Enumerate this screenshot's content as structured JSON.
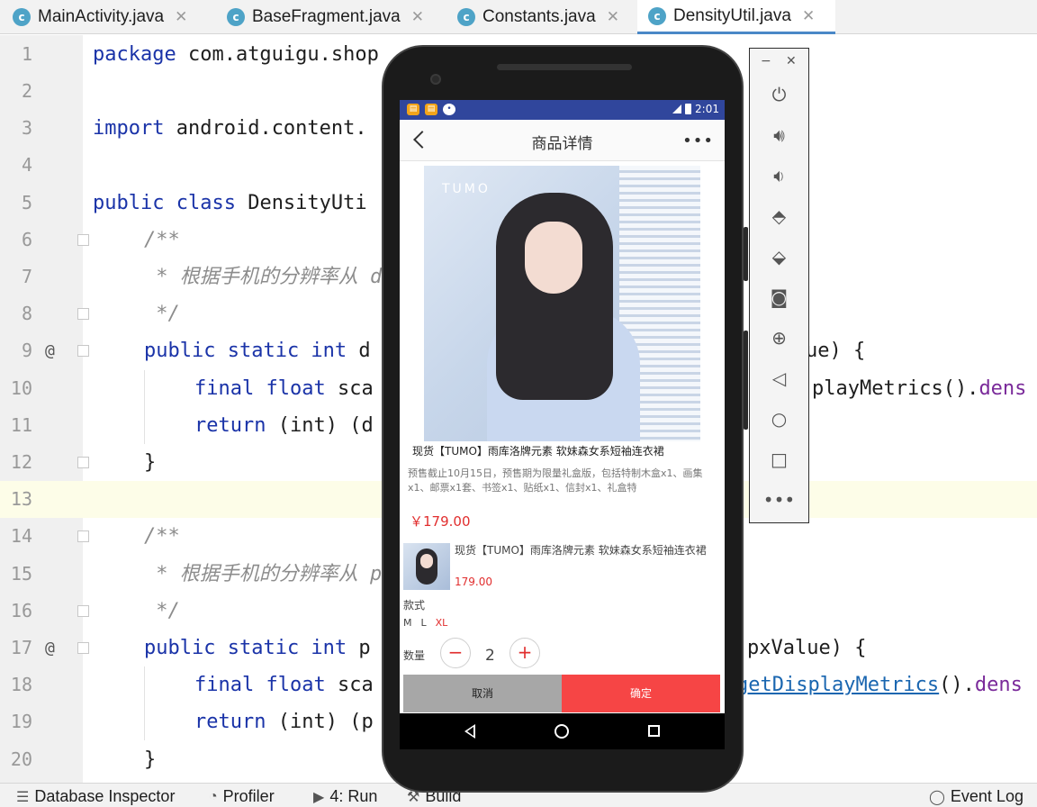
{
  "tabs": [
    {
      "label": "MainActivity.java",
      "icon": "c"
    },
    {
      "label": "BaseFragment.java",
      "icon": "c"
    },
    {
      "label": "Constants.java",
      "icon": "c"
    },
    {
      "label": "DensityUtil.java",
      "icon": "c"
    }
  ],
  "editor": {
    "line_numbers": [
      "1",
      "2",
      "3",
      "4",
      "5",
      "6",
      "7",
      "8",
      "9",
      "10",
      "11",
      "12",
      "13",
      "14",
      "15",
      "16",
      "17",
      "18",
      "19",
      "20"
    ],
    "lines": {
      "l1_pkg_kw": "package",
      "l1_pkg_name": " com.atguigu.shop",
      "l3_import_kw": "import",
      "l3_import_name": " android.content.",
      "l5_kw": "public class",
      "l5_name": " DensityUti",
      "l6": "/**",
      "l7": " * 根据手机的分辨率从 d",
      "l8": " */",
      "l9_kw": "public static int",
      "l9_name": " d",
      "l9_right": "ue) {",
      "l10_kw": "final float",
      "l10_name": " sca",
      "l10_right_a": "playMetrics().",
      "l10_right_b": "dens",
      "l11_kw": "return",
      "l11_rest": " (int) (d",
      "l12": "}",
      "l14": "/**",
      "l15": " * 根据手机的分辨率从 p",
      "l16": " */",
      "l17_kw": "public static int",
      "l17_name": " p",
      "l17_right": "pxValue) {",
      "l18_kw": "final float",
      "l18_name": " sca",
      "l18_right_a": "getDisplayMetrics",
      "l18_right_b": "().",
      "l18_right_c": "dens",
      "l19_kw": "return",
      "l19_rest": " (int) (p",
      "l20": "}",
      "at_marker": "@"
    }
  },
  "bottom_bar": {
    "database_inspector": "Database Inspector",
    "profiler": "Profiler",
    "run": "4: Run",
    "build": "Build",
    "event_log": "Event Log"
  },
  "phone": {
    "status_time": "2:01",
    "app_title": "商品详情",
    "photo_brand": "TUMO",
    "product_title": "现货【TUMO】雨库洛牌元素 软妹森女系短袖连衣裙",
    "product_desc": "预售截止10月15日，预售期为限量礼盒版，包括特制木盒x1、画集x1、邮票x1套、书签x1、贴纸x1、信封x1、礼盒特",
    "price": "￥179.00",
    "sheet": {
      "name": "现货【TUMO】雨库洛牌元素 软妹森女系短袖连衣裙",
      "price": "179.00",
      "style_label": "款式",
      "sizes": [
        "M",
        "L",
        "XL"
      ],
      "selected_size": "XL",
      "qty_label": "数量",
      "qty_minus": "−",
      "qty_value": "2",
      "qty_plus": "+",
      "cancel": "取消",
      "confirm": "确定"
    }
  },
  "colors": {
    "accent_red": "#e12e2e",
    "confirm_bg": "#f64545",
    "cancel_bg": "#a7a7a7",
    "status_bar": "#30469c",
    "keyword": "#1a33a8",
    "tab_active_underline": "#4a88c7"
  },
  "panel_icons": [
    "power-icon",
    "volume-up-icon",
    "volume-down-icon",
    "rotate-left-icon",
    "rotate-right-icon",
    "camera-icon",
    "zoom-icon",
    "back-icon",
    "home-icon",
    "overview-icon",
    "more-icon"
  ]
}
